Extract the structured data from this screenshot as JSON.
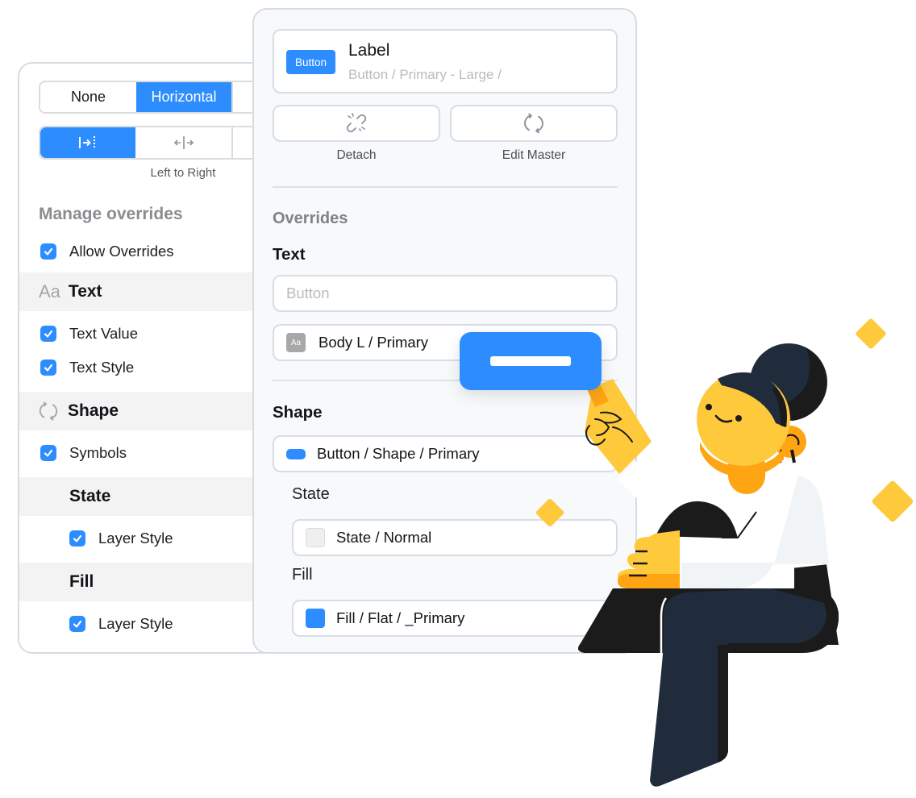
{
  "colors": {
    "accent": "#2d8dff",
    "skin": "#ffc93c",
    "skin_shadow": "#ffa412",
    "hair": "#202c3c",
    "dark": "#1b1b1b",
    "shirt": "#f1f4f7",
    "panel_border": "#d6dce4"
  },
  "left_panel": {
    "layout_segment": {
      "options": [
        "None",
        "Horizontal"
      ],
      "selected": "Horizontal"
    },
    "direction_segment": {
      "options": [
        {
          "icon": "align-left-to-right-icon",
          "glyph": "|→⋮"
        },
        {
          "icon": "align-center-out-icon",
          "glyph": "←|→"
        }
      ],
      "selected_index": 0,
      "caption": "Left to Right"
    },
    "manage_overrides_title": "Manage overrides",
    "allow_overrides": {
      "label": "Allow Overrides",
      "checked": true
    },
    "sections": [
      {
        "title": "Text",
        "icon": "text-style-icon",
        "icon_glyph": "Aa",
        "items": [
          {
            "label": "Text Value",
            "checked": true
          },
          {
            "label": "Text Style",
            "checked": true
          }
        ]
      },
      {
        "title": "Shape",
        "icon": "sync-icon",
        "items": [
          {
            "label": "Symbols",
            "checked": true
          }
        ]
      },
      {
        "title": "State",
        "items": [
          {
            "label": "Layer Style",
            "checked": true
          }
        ]
      },
      {
        "title": "Fill",
        "items": [
          {
            "label": "Layer Style",
            "checked": true
          }
        ]
      }
    ]
  },
  "right_panel": {
    "symbol_card": {
      "badge": "Button",
      "title": "Label",
      "path": "Button / Primary - Large /"
    },
    "actions": [
      {
        "label": "Detach",
        "icon": "unlink-icon"
      },
      {
        "label": "Edit Master",
        "icon": "sync-icon"
      }
    ],
    "overrides_title": "Overrides",
    "text_section": {
      "title": "Text",
      "input_placeholder": "Button",
      "input_value": "",
      "style_chip": "Aa",
      "style_value": "Body L / Primary"
    },
    "shape_section": {
      "title": "Shape",
      "shape_value": "Button / Shape / Primary",
      "state_label": "State",
      "state_value": "State / Normal",
      "state_swatch": "#efefef",
      "fill_label": "Fill",
      "fill_value": "Fill / Flat / _Primary",
      "fill_swatch": "#2d8dff"
    }
  }
}
